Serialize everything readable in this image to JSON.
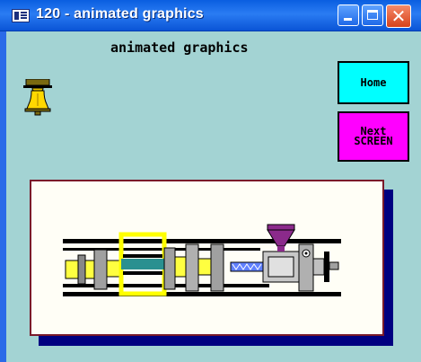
{
  "window": {
    "title": "120 - animated graphics",
    "icon": "window-app-icon",
    "controls": {
      "minimize": "minimize-icon",
      "maximize": "maximize-icon",
      "close": "close-icon",
      "close_glyph": "✕"
    },
    "colors": {
      "titlebar": "#0a5ee0",
      "client": "#a3d3d3"
    }
  },
  "page": {
    "heading": "animated graphics",
    "logo_icon": "liberty-bell-icon"
  },
  "buttons": {
    "home": {
      "label": "Home",
      "color": "#00ffff"
    },
    "next": {
      "line1": "Next",
      "line2": "SCREEN",
      "color": "#ff00ff"
    }
  },
  "graphic": {
    "subject": "injection-molding-machine-icon",
    "colors": {
      "frame": "#fffef6",
      "border": "#7a1a2a",
      "shadow": "#000080",
      "mold_platen": "#ffff00",
      "core": "#2a9090",
      "hopper": "#8b2a8b"
    }
  }
}
